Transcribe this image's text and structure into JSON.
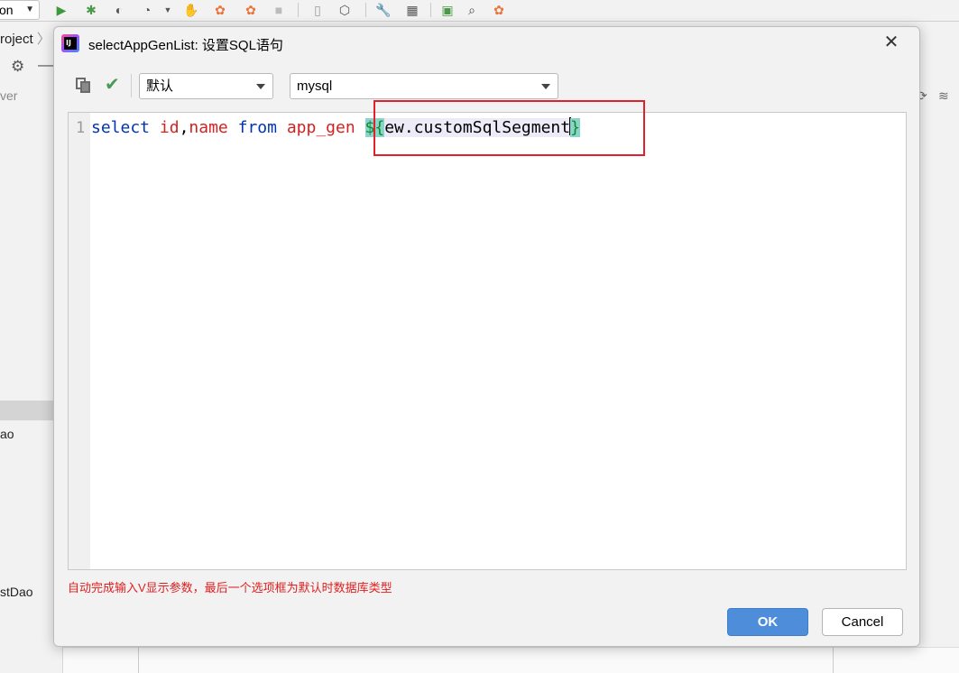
{
  "ide": {
    "run_config": "on",
    "project_label": "roject",
    "side_text_1": "ver",
    "side_text_2": "ao",
    "side_text_3": "stDao"
  },
  "dialog": {
    "title": "selectAppGenList: 设置SQL语句",
    "toolbar": {
      "dialect_select": "默认",
      "database_select": "mysql"
    },
    "editor": {
      "line_number": "1",
      "tokens": {
        "select": "select",
        "id": "id",
        "comma": ",",
        "name": "name",
        "from": "from",
        "table": "app_gen",
        "open": "${",
        "param": "ew.customSqlSegment",
        "close": "}"
      }
    },
    "hint": "自动完成输入V显示参数，最后一个选项框为默认时数据库类型",
    "ok_label": "OK",
    "cancel_label": "Cancel"
  },
  "colors": {
    "keyword": "#0033b3",
    "identifier": "#d42222",
    "brace": "#118a2b",
    "highlight_box": "#e0212b",
    "ok_button": "#4d8dd9",
    "hint_text": "#e01e1e"
  }
}
